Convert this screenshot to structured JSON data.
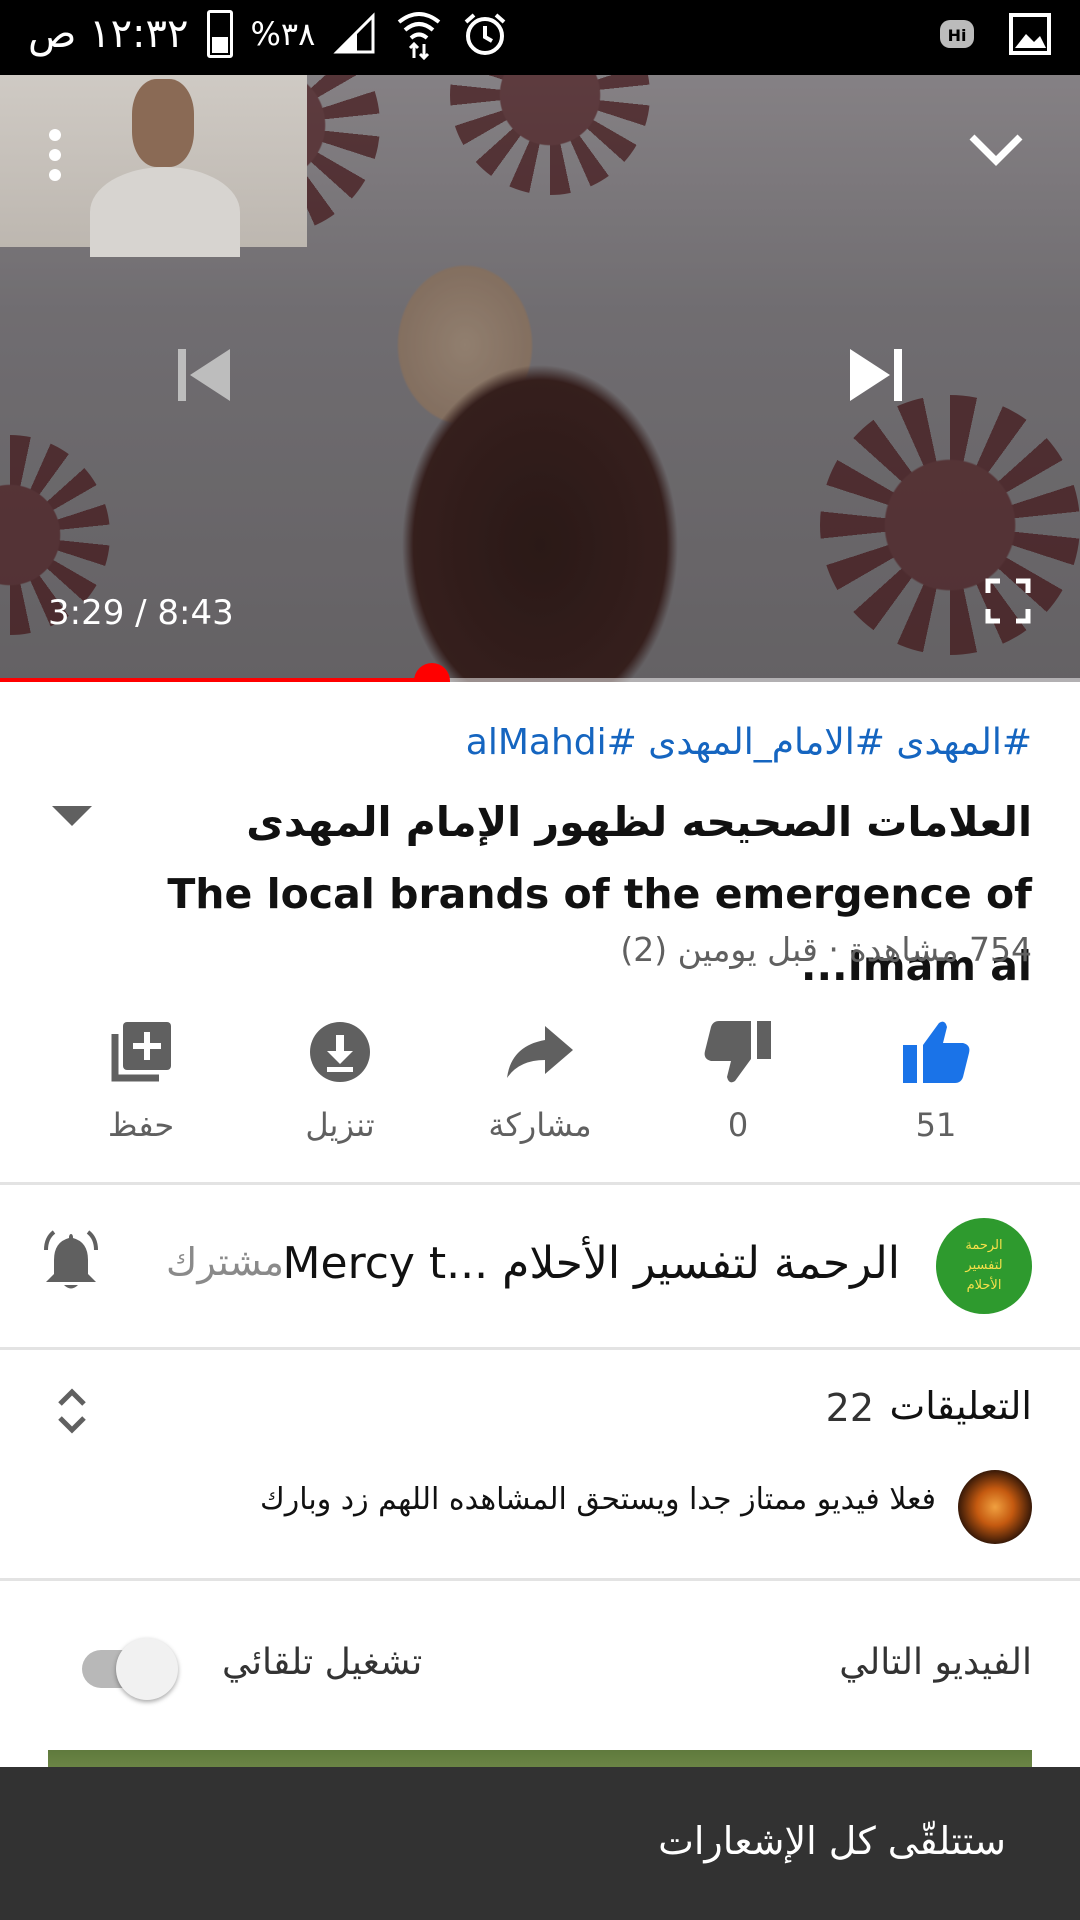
{
  "status_bar": {
    "time": "١٢:٣٢ ص",
    "battery": "%٣٨",
    "icons": [
      "signal-icon",
      "wifi-icon",
      "alarm-icon",
      "hi-icon",
      "gallery-icon"
    ]
  },
  "player": {
    "time_current": "3:29",
    "time_total": "8:43",
    "time_display": "3:29 / 8:43",
    "progress_fraction": 0.4,
    "icons": [
      "more-vert-icon",
      "chevron-down-icon",
      "skip-previous-icon",
      "skip-next-icon",
      "fullscreen-icon"
    ]
  },
  "video": {
    "hashtags": "#المهدى #الامام_المهدى #alMahdi",
    "title": "العلامات الصحيحه لظهور الإمام المهدى The local brands of the emergence of Imam al...",
    "meta": "754 مشاهدة · قبل يومين (2)"
  },
  "actions": {
    "like_count": "51",
    "dislike_count": "0",
    "share_label": "مشاركة",
    "download_label": "تنزيل",
    "save_label": "حفظ"
  },
  "channel": {
    "name": "الرحمة لتفسير الأحلام ...Mercy t",
    "avatar_text_1": "الرحمة",
    "avatar_text_2": "لتفسير",
    "avatar_text_3": "الأحلام",
    "subscribed_label": "مشترك"
  },
  "comments": {
    "title": "التعليقات",
    "count": "22",
    "top_comment": "فعلا فيديو ممتاز جدا ويستحق المشاهده اللهم زد وبارك"
  },
  "up_next": {
    "label": "الفيديو التالي",
    "autoplay_label": "تشغيل تلقائي",
    "autoplay_on": false
  },
  "snackbar": {
    "message": "ستتلقّى كل الإشعارات"
  },
  "colors": {
    "accent_red": "#ff0000",
    "link_blue": "#1565c0",
    "like_blue": "#1a73e8"
  }
}
